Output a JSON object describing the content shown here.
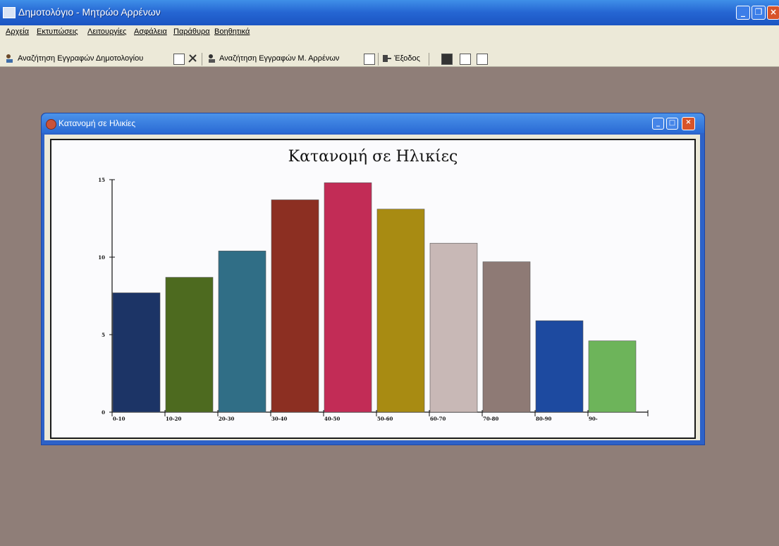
{
  "app": {
    "title": "Δημοτολόγιο - Μητρώο Αρρένων",
    "icon": "app-icon"
  },
  "menu": [
    "Αρχεία",
    "Εκτυπώσεις",
    "Λειτουργίες",
    "Ασφάλεια",
    "Παράθυρα",
    "Βοηθητικά"
  ],
  "toolbar": {
    "search_municipal": "Αναζήτηση Εγγραφών Δημοτολογίου",
    "search_male_registry": "Αναζήτηση Εγγραφών Μ. Αρρένων",
    "exit": "Έξοδος"
  },
  "child_window": {
    "title": "Κατανομή σε Ηλικίες"
  },
  "chart_data": {
    "type": "bar",
    "title": "Κατανομή σε Ηλικίες",
    "categories": [
      "0-10",
      "10-20",
      "20-30",
      "30-40",
      "40-50",
      "50-60",
      "60-70",
      "70-80",
      "80-90",
      "90-"
    ],
    "values": [
      7.7,
      8.7,
      10.4,
      13.7,
      14.8,
      13.1,
      10.9,
      9.7,
      5.9,
      4.6
    ],
    "colors": [
      "#1c3466",
      "#4d6a1f",
      "#306e86",
      "#8c2f22",
      "#c22c56",
      "#a88b12",
      "#c8b8b6",
      "#8e7a75",
      "#1d4aa0",
      "#6db45a"
    ],
    "yticks": [
      "0",
      "5",
      "10",
      "15"
    ],
    "ylim": [
      0,
      15
    ],
    "xlabel": "",
    "ylabel": "",
    "grid": false
  }
}
